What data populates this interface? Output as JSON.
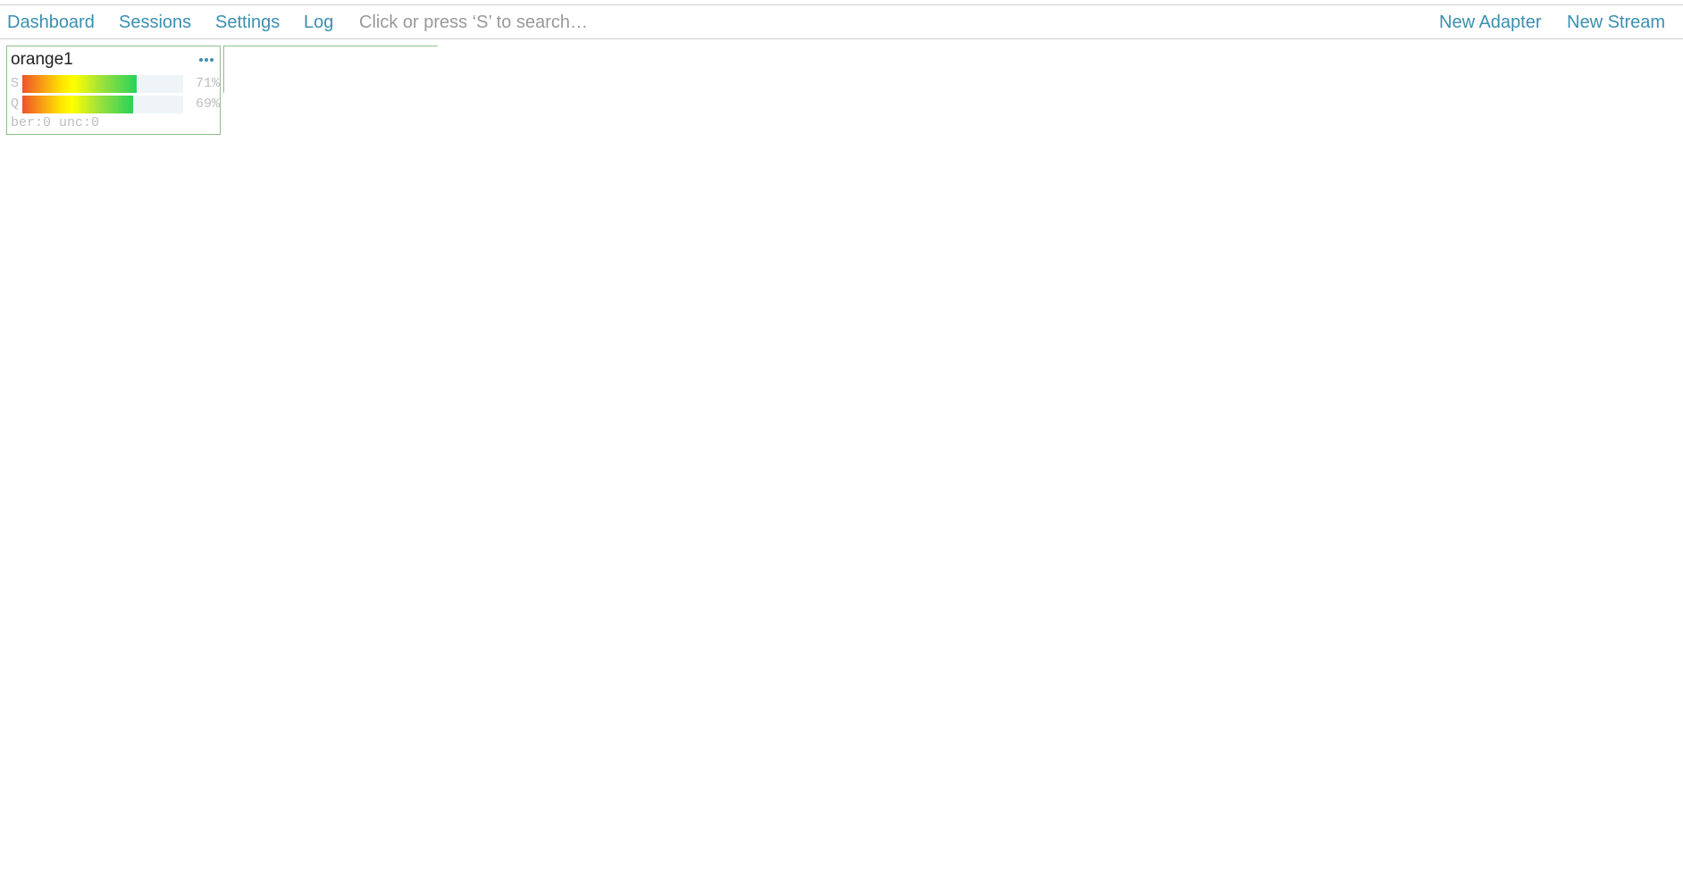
{
  "nav": {
    "left_links": [
      "Dashboard",
      "Sessions",
      "Settings",
      "Log"
    ],
    "search": {
      "placeholder": "Click or press ‘S’ to search…",
      "value": ""
    },
    "right_links": [
      "New Adapter",
      "New Stream"
    ]
  },
  "colors": {
    "link": "#3b8fb0",
    "card_border": "#8dbf8d",
    "meter_low": "#f0522a",
    "meter_mid": "#ffff00",
    "meter_high": "#27d35a"
  },
  "adapters": [
    {
      "name": "orange1",
      "menu_icon": "more-horizontal-icon",
      "meters": [
        {
          "label": "S",
          "percent_text": "71%",
          "value": 0.71
        },
        {
          "label": "Q",
          "percent_text": "69%",
          "value": 0.69
        }
      ],
      "stats": "ber:0 unc:0"
    }
  ]
}
